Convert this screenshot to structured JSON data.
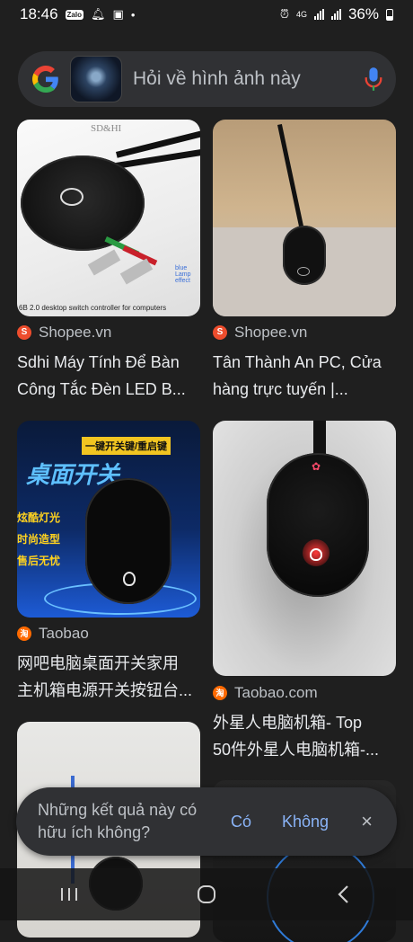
{
  "status": {
    "time": "18:46",
    "battery": "36%",
    "network": "4G",
    "icons": [
      "zalo-icon",
      "bell-icon",
      "gallery-icon",
      "dot-icon",
      "alarm-icon",
      "signal-icon",
      "battery-icon"
    ]
  },
  "search": {
    "placeholder": "Hỏi về hình ảnh này"
  },
  "results": [
    {
      "source": "Shopee.vn",
      "title_line1": "Sdhi Máy Tính Để Bàn",
      "title_line2": "Công Tắc Đèn LED B...",
      "image_text_top": "SD&HI",
      "image_text_bottom": "6B 2.0 desktop switch controller for computers"
    },
    {
      "source": "Shopee.vn",
      "title_line1": "Tân Thành An PC, Cửa",
      "title_line2": "hàng trực tuyến |..."
    },
    {
      "source": "Taobao",
      "title_line1": "网吧电脑桌面开关家用",
      "title_line2": "主机箱电源开关按钮台...",
      "image_text_banner": "一键开关键/重启键",
      "image_text_big": "桌面开关",
      "image_text_side": [
        "炫酷灯光",
        "时尚造型",
        "售后无忧"
      ]
    },
    {
      "source": "Taobao.com",
      "title_line1": "外星人电脑机箱- Top",
      "title_line2": "50件外星人电脑机箱-..."
    }
  ],
  "feedback": {
    "question": "Những kết quả này có hữu ích không?",
    "yes": "Có",
    "no": "Không",
    "close": "×"
  },
  "colors": {
    "background": "#1f1f1f",
    "search_bg": "#303134",
    "link": "#8ab4f8",
    "shopee": "#ee4d2d",
    "taobao": "#ff6a00"
  }
}
